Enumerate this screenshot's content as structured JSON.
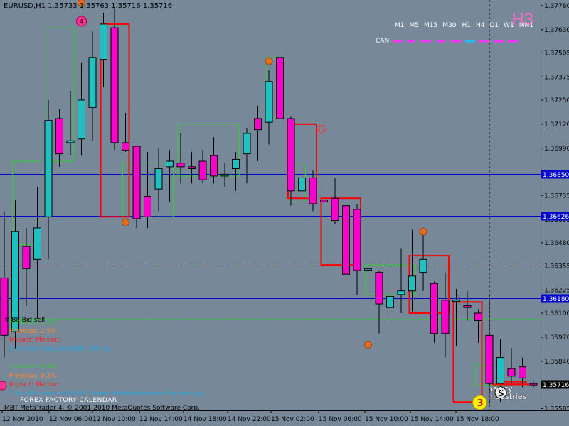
{
  "header": {
    "symbol_text": "EURUSD,H1  1.35733  1.35763  1.35716  1.35716",
    "tf_big": "H3",
    "timeframes": [
      "M1",
      "M5",
      "M15",
      "M30",
      "H1",
      "H4",
      "D1",
      "W1",
      "MN1"
    ],
    "can_label": "CAN"
  },
  "news": [
    {
      "lines": [
        {
          "text": "Forecast: 1.5%",
          "color": "#33cc33"
        },
        {
          "text": "Previous: 1.5%",
          "color": "#ff8833"
        },
        {
          "text": "Impact: Medium",
          "color": "#ff2222"
        },
        {
          "text": "2 hrs 55 mins until EUR: CPI y/y",
          "color": "#1fa7e0"
        }
      ]
    },
    {
      "lines": [
        {
          "text": "Forecast: 0.4%",
          "color": "#33cc33"
        },
        {
          "text": "Previous: 0.2%",
          "color": "#ff8833"
        },
        {
          "text": "Impact: Medium",
          "color": "#ff2222"
        },
        {
          "text": "7 hrs 40 mins until EUR: French Prelim Non-Farm Payrolls q/q",
          "color": "#1fa7e0"
        }
      ]
    }
  ],
  "signal_label": "# Bk Bid sell",
  "calendar_label": "FOREX FACTORY CALENDAR",
  "copyright": "MBT MetaTrader 4, © 2001-2010 MetaQuotes Software Corp.",
  "brand": {
    "line1": "Sanity",
    "line2": "Industries",
    "initial": "S"
  },
  "markers": {
    "top_number": "4",
    "bottom_number": "3"
  },
  "colors": {
    "background": "#778899",
    "bull_candle": "#20c0c0",
    "bear_candle": "#ff00cc",
    "box_up": "#33cc33",
    "box_down": "#ff0000",
    "hline": "#0000cc",
    "dash_red": "#cc0000",
    "dash_green": "#33cc33",
    "fractal": "#e07020",
    "price_label_bg": "#0000cc",
    "current_price_bg": "#000000"
  },
  "chart_data": {
    "type": "candlestick",
    "symbol": "EURUSD",
    "timeframe": "H1",
    "ylim": [
      1.35575,
      1.3779
    ],
    "y_ticks": [
      1.3776,
      1.3763,
      1.37505,
      1.37375,
      1.3725,
      1.3712,
      1.3699,
      1.36735,
      1.36605,
      1.3648,
      1.36355,
      1.36225,
      1.361,
      1.3597,
      1.3584,
      1.35585
    ],
    "x_labels": [
      "12 Nov 2010",
      "12 Nov 06:00",
      "12 Nov 10:00",
      "12 Nov 14:00",
      "14 Nov 18:00",
      "14 Nov 22:00",
      "15 Nov 02:00",
      "15 Nov 06:00",
      "15 Nov 10:00",
      "15 Nov 14:00",
      "15 Nov 18:00"
    ],
    "hlines": [
      {
        "price": 1.3685,
        "label": "1.36850",
        "style": "solid"
      },
      {
        "price": 1.36626,
        "label": "1.36626",
        "style": "solid"
      },
      {
        "price": 1.3618,
        "label": "1.36180",
        "style": "solid"
      },
      {
        "price": 1.36355,
        "style": "dashdot-red"
      },
      {
        "price": 1.3607,
        "style": "dash-green"
      }
    ],
    "current_price": "1.35716",
    "candles": [
      [
        1.3629,
        1.3665,
        1.3586,
        1.3598
      ],
      [
        1.36,
        1.3671,
        1.3591,
        1.3654
      ],
      [
        1.3646,
        1.3656,
        1.3614,
        1.3634
      ],
      [
        1.3639,
        1.3678,
        1.3607,
        1.3656
      ],
      [
        1.3662,
        1.3725,
        1.3639,
        1.3714
      ],
      [
        1.3715,
        1.372,
        1.3689,
        1.3696
      ],
      [
        1.3702,
        1.373,
        1.3695,
        1.3703
      ],
      [
        1.3704,
        1.3745,
        1.3695,
        1.3725
      ],
      [
        1.3721,
        1.3762,
        1.3703,
        1.3748
      ],
      [
        1.3747,
        1.3772,
        1.3732,
        1.3766
      ],
      [
        1.3764,
        1.3775,
        1.3698,
        1.3702
      ],
      [
        1.3702,
        1.3718,
        1.3697,
        1.3698
      ],
      [
        1.37,
        1.37,
        1.3656,
        1.3661
      ],
      [
        1.3673,
        1.3697,
        1.3656,
        1.3662
      ],
      [
        1.3677,
        1.3699,
        1.3665,
        1.3688
      ],
      [
        1.3689,
        1.3698,
        1.367,
        1.3692
      ],
      [
        1.3691,
        1.3707,
        1.368,
        1.3689
      ],
      [
        1.3689,
        1.3697,
        1.368,
        1.3688
      ],
      [
        1.3692,
        1.3698,
        1.368,
        1.3682
      ],
      [
        1.3695,
        1.3705,
        1.368,
        1.3684
      ],
      [
        1.3684,
        1.3691,
        1.3678,
        1.3685
      ],
      [
        1.3688,
        1.3697,
        1.3676,
        1.3693
      ],
      [
        1.3696,
        1.371,
        1.368,
        1.3707
      ],
      [
        1.3715,
        1.3722,
        1.3692,
        1.3709
      ],
      [
        1.3713,
        1.3741,
        1.3701,
        1.3735
      ],
      [
        1.3748,
        1.375,
        1.3714,
        1.3715
      ],
      [
        1.3715,
        1.3716,
        1.3668,
        1.3676
      ],
      [
        1.3676,
        1.3688,
        1.366,
        1.3683
      ],
      [
        1.3683,
        1.3687,
        1.3665,
        1.3669
      ],
      [
        1.3671,
        1.368,
        1.3662,
        1.367
      ],
      [
        1.3672,
        1.3683,
        1.3658,
        1.366
      ],
      [
        1.3668,
        1.3669,
        1.3619,
        1.3631
      ],
      [
        1.3666,
        1.3669,
        1.362,
        1.3633
      ],
      [
        1.3634,
        1.3635,
        1.3619,
        1.3634
      ],
      [
        1.3632,
        1.3633,
        1.3599,
        1.3615
      ],
      [
        1.3613,
        1.3637,
        1.3605,
        1.3619
      ],
      [
        1.362,
        1.3645,
        1.361,
        1.3622
      ],
      [
        1.3622,
        1.3655,
        1.3611,
        1.363
      ],
      [
        1.3632,
        1.3653,
        1.3622,
        1.3639
      ],
      [
        1.3626,
        1.3627,
        1.3594,
        1.3599
      ],
      [
        1.3617,
        1.3632,
        1.3586,
        1.3599
      ],
      [
        1.3617,
        1.3623,
        1.3592,
        1.3617
      ],
      [
        1.3614,
        1.3622,
        1.3606,
        1.3613
      ],
      [
        1.361,
        1.3612,
        1.3594,
        1.3606
      ],
      [
        1.3598,
        1.362,
        1.3561,
        1.3572
      ],
      [
        1.3572,
        1.3596,
        1.3562,
        1.3586
      ],
      [
        1.358,
        1.3591,
        1.3571,
        1.3576
      ],
      [
        1.3581,
        1.3586,
        1.357,
        1.3575
      ],
      [
        1.3572,
        1.3573,
        1.357,
        1.35716
      ]
    ],
    "boxes_green": [
      [
        1,
        3,
        1.3647,
        1.3692
      ],
      [
        4,
        6,
        1.3692,
        1.3764
      ],
      [
        11,
        15,
        1.3662,
        1.3691
      ],
      [
        16,
        21,
        1.3684,
        1.3712
      ],
      [
        24,
        25,
        1.3715,
        1.3748
      ],
      [
        26,
        27,
        1.367,
        1.369
      ],
      [
        33,
        37,
        1.362,
        1.3636
      ],
      [
        43,
        45,
        1.3571,
        1.3582
      ]
    ],
    "boxes_red": [
      [
        9,
        11,
        1.3662,
        1.3766
      ],
      [
        26,
        28,
        1.3672,
        1.3712
      ],
      [
        29,
        32,
        1.3636,
        1.3672
      ],
      [
        37,
        40,
        1.361,
        1.3641
      ],
      [
        41,
        43,
        1.3562,
        1.3616
      ],
      [
        45,
        47,
        1.35716,
        1.3573
      ]
    ],
    "fractals_up": [
      {
        "index": 7,
        "price": 1.37775
      },
      {
        "index": 24,
        "price": 1.3746
      },
      {
        "index": 38,
        "price": 1.3654
      }
    ],
    "fractals_down": [
      {
        "index": 11,
        "price": 1.3659
      },
      {
        "index": 33,
        "price": 1.3593
      }
    ],
    "arrow_down": {
      "index": 28,
      "price": 1.3709
    },
    "signal_number": {
      "index": 0,
      "price": 1.361
    },
    "vline_index": 44
  }
}
